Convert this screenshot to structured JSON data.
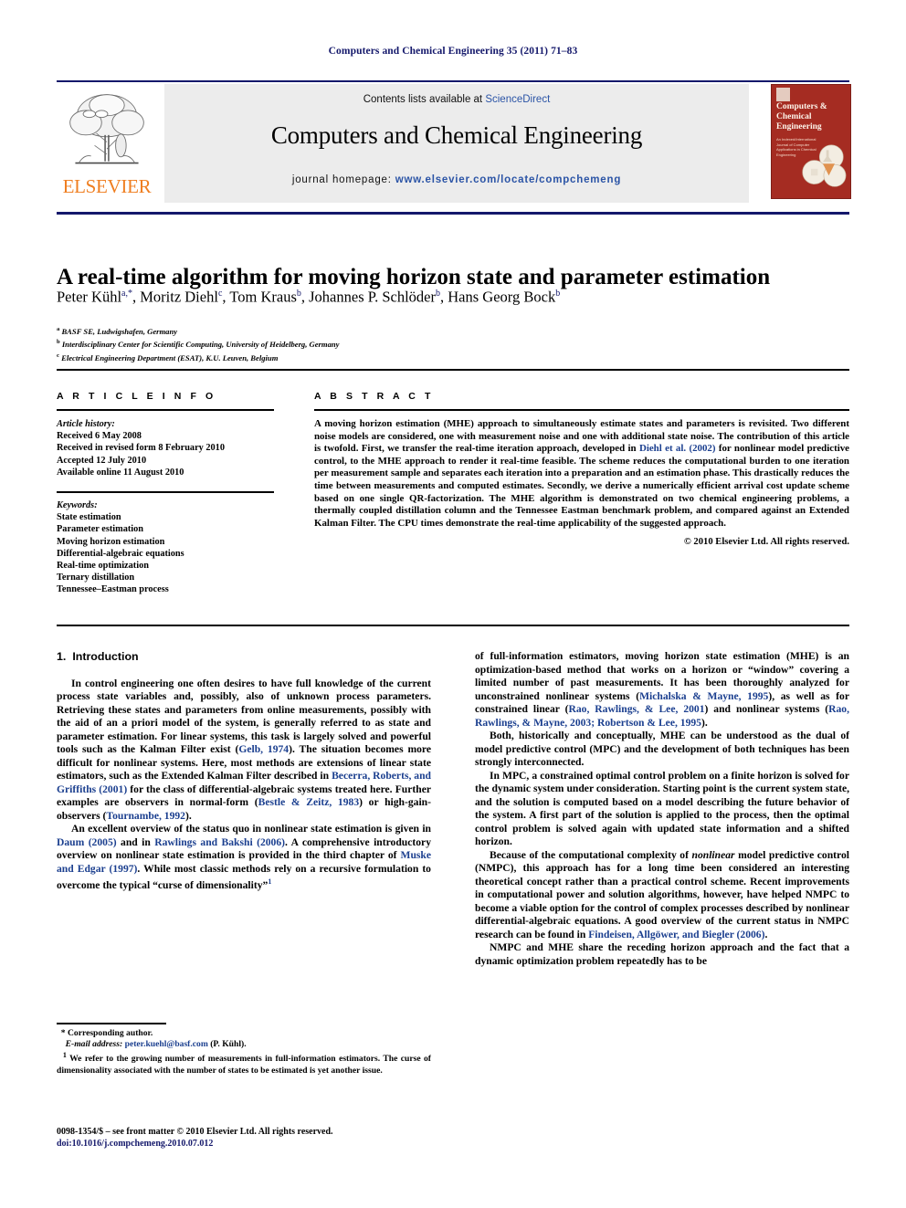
{
  "running_head": "Computers and Chemical Engineering 35 (2011) 71–83",
  "masthead": {
    "contents_prefix": "Contents lists available at ",
    "sciencedirect": "ScienceDirect",
    "journal_title": "Computers and Chemical Engineering",
    "homepage_prefix": "journal homepage: ",
    "homepage_url": "www.elsevier.com/locate/compchemeng",
    "publisher_logo_text": "ELSEVIER",
    "publisher_logo_icon": "elsevier-tree-icon",
    "cover_title": "Computers & Chemical Engineering",
    "cover_subtitle": "An Indexed/International Journal of Computer Applications in Chemical Engineering",
    "brand_blue": "#14186b",
    "brand_orange": "#ef7e20",
    "cover_red": "#a52c22",
    "band_grey": "#ececec",
    "link_blue": "#2b54a6"
  },
  "article": {
    "title": "A real-time algorithm for moving horizon state and parameter estimation",
    "authors": [
      {
        "name": "Peter Kühl",
        "marks": "a,*"
      },
      {
        "name": "Moritz Diehl",
        "marks": "c"
      },
      {
        "name": "Tom Kraus",
        "marks": "b"
      },
      {
        "name": "Johannes P. Schlöder",
        "marks": "b"
      },
      {
        "name": "Hans Georg Bock",
        "marks": "b"
      }
    ],
    "affiliations": [
      {
        "mark": "a",
        "text": "BASF SE, Ludwigshafen, Germany"
      },
      {
        "mark": "b",
        "text": "Interdisciplinary Center for Scientific Computing, University of Heidelberg, Germany"
      },
      {
        "mark": "c",
        "text": "Electrical Engineering Department (ESAT), K.U. Leuven, Belgium"
      }
    ]
  },
  "article_info": {
    "heading": "A R T I C L E    I N F O",
    "history_heading": "Article history:",
    "history": [
      "Received 6 May 2008",
      "Received in revised form 8 February 2010",
      "Accepted 12 July 2010",
      "Available online 11 August 2010"
    ],
    "keywords_heading": "Keywords:",
    "keywords": [
      "State estimation",
      "Parameter estimation",
      "Moving horizon estimation",
      "Differential-algebraic equations",
      "Real-time optimization",
      "Ternary distillation",
      "Tennessee–Eastman process"
    ]
  },
  "abstract": {
    "heading": "A B S T R A C T",
    "part1": "A moving horizon estimation (MHE) approach to simultaneously estimate states and parameters is revisited. Two different noise models are considered, one with measurement noise and one with additional state noise. The contribution of this article is twofold. First, we transfer the real-time iteration approach, developed in ",
    "citation1": "Diehl et al. (2002)",
    "part2": " for nonlinear model predictive control, to the MHE approach to render it real-time feasible. The scheme reduces the computational burden to one iteration per measurement sample and separates each iteration into a preparation and an estimation phase. This drastically reduces the time between measurements and computed estimates. Secondly, we derive a numerically efficient arrival cost update scheme based on one single QR-factorization. The MHE algorithm is demonstrated on two chemical engineering problems, a thermally coupled distillation column and the Tennessee Eastman benchmark problem, and compared against an Extended Kalman Filter. The CPU times demonstrate the real-time applicability of the suggested approach.",
    "copyright": "© 2010 Elsevier Ltd. All rights reserved."
  },
  "body": {
    "section_number": "1.",
    "section_title": "Introduction",
    "left_paragraphs": [
      {
        "runs": [
          {
            "t": "In control engineering one often desires to have full knowledge of the current process state variables and, possibly, also of unknown process parameters. Retrieving these states and parameters from online measurements, possibly with the aid of an a priori model of the system, is generally referred to as state and parameter estimation. For linear systems, this task is largely solved and powerful tools such as the Kalman Filter exist ("
          },
          {
            "t": "Gelb, 1974",
            "cite": true
          },
          {
            "t": "). The situation becomes more difficult for nonlinear systems. Here, most methods are extensions of linear state estimators, such as the Extended Kalman Filter described in "
          },
          {
            "t": "Becerra, Roberts, and Griffiths (2001)",
            "cite": true
          },
          {
            "t": " for the class of differential-algebraic systems treated here. Further examples are observers in normal-form ("
          },
          {
            "t": "Bestle & Zeitz, 1983",
            "cite": true
          },
          {
            "t": ") or high-gain-observers ("
          },
          {
            "t": "Tournambe, 1992",
            "cite": true
          },
          {
            "t": ")."
          }
        ]
      },
      {
        "runs": [
          {
            "t": "An excellent overview of the status quo in nonlinear state estimation is given in "
          },
          {
            "t": "Daum (2005)",
            "cite": true
          },
          {
            "t": " and in "
          },
          {
            "t": "Rawlings and Bakshi (2006)",
            "cite": true
          },
          {
            "t": ". A comprehensive introductory overview on nonlinear state estimation is provided in the third chapter of "
          },
          {
            "t": "Muske and Edgar (1997)",
            "cite": true
          },
          {
            "t": ". While most classic methods rely on a recursive formulation to overcome the typical “curse of dimensionality”"
          },
          {
            "t": "1",
            "sup": true
          }
        ]
      }
    ],
    "right_paragraphs": [
      {
        "noindent": true,
        "runs": [
          {
            "t": "of full-information estimators, moving horizon state estimation (MHE) is an optimization-based method that works on a horizon or “window” covering a limited number of past measurements. It has been thoroughly analyzed for unconstrained nonlinear systems ("
          },
          {
            "t": "Michalska & Mayne, 1995",
            "cite": true
          },
          {
            "t": "), as well as for constrained linear ("
          },
          {
            "t": "Rao, Rawlings, & Lee, 2001",
            "cite": true
          },
          {
            "t": ") and nonlinear systems ("
          },
          {
            "t": "Rao, Rawlings, & Mayne, 2003; Robertson & Lee, 1995",
            "cite": true
          },
          {
            "t": ")."
          }
        ]
      },
      {
        "runs": [
          {
            "t": "Both, historically and conceptually, MHE can be understood as the dual of model predictive control (MPC) and the development of both techniques has been strongly interconnected."
          }
        ]
      },
      {
        "runs": [
          {
            "t": "In MPC, a constrained optimal control problem on a finite horizon is solved for the dynamic system under consideration. Starting point is the current system state, and the solution is computed based on a model describing the future behavior of the system. A first part of the solution is applied to the process, then the optimal control problem is solved again with updated state information and a shifted horizon."
          }
        ]
      },
      {
        "runs": [
          {
            "t": "Because of the computational complexity of "
          },
          {
            "t": "nonlinear",
            "italic": true
          },
          {
            "t": " model predictive control (NMPC), this approach has for a long time been considered an interesting theoretical concept rather than a practical control scheme. Recent improvements in computational power and solution algorithms, however, have helped NMPC to become a viable option for the control of complex processes described by nonlinear differential-algebraic equations. A good overview of the current status in NMPC research can be found in "
          },
          {
            "t": "Findeisen, Allgöwer, and Biegler (2006)",
            "cite": true
          },
          {
            "t": "."
          }
        ]
      },
      {
        "runs": [
          {
            "t": "NMPC and MHE share the receding horizon approach and the fact that a dynamic optimization problem repeatedly has to be"
          }
        ]
      }
    ]
  },
  "footnotes": {
    "corresponding_mark": "*",
    "corresponding_text": "Corresponding author.",
    "email_label": "E-mail address:",
    "email": "peter.kuehl@basf.com",
    "email_suffix": "(P. Kühl).",
    "note1_mark": "1",
    "note1_text": "We refer to the growing number of measurements in full-information estimators. The curse of dimensionality associated with the number of states to be estimated is yet another issue."
  },
  "imprint": {
    "line1": "0098-1354/$ – see front matter © 2010 Elsevier Ltd. All rights reserved.",
    "line2": "doi:10.1016/j.compchemeng.2010.07.012"
  }
}
